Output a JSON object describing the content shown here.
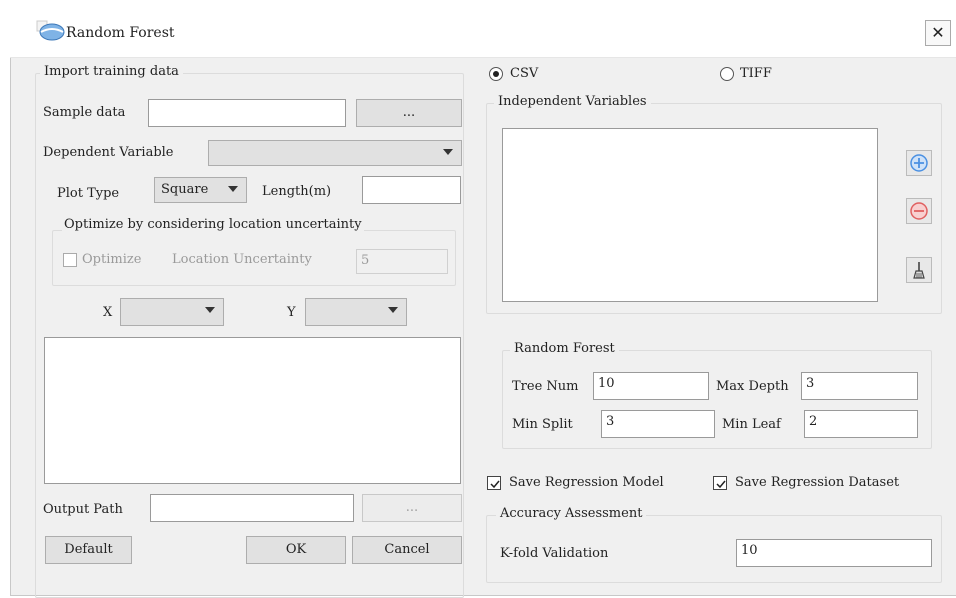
{
  "window": {
    "title": "Random Forest",
    "close_glyph": "✕"
  },
  "import": {
    "group_title": "Import training data",
    "sample_data_label": "Sample data",
    "sample_data_value": "",
    "browse_label": "...",
    "dependent_label": "Dependent Variable",
    "dependent_value": "",
    "plot_type_label": "Plot Type",
    "plot_type_value": "Square",
    "length_label": "Length(m)",
    "length_value": "",
    "optimize_group_title": "Optimize by considering location uncertainty",
    "optimize_label": "Optimize",
    "optimize_checked": false,
    "location_uncertainty_label": "Location Uncertainty",
    "location_uncertainty_value": "5",
    "x_label": "X",
    "x_value": "",
    "y_label": "Y",
    "y_value": ""
  },
  "output": {
    "path_label": "Output Path",
    "path_value": "",
    "browse_label": "..."
  },
  "buttons": {
    "default": "Default",
    "ok": "OK",
    "cancel": "Cancel"
  },
  "format": {
    "csv_label": "CSV",
    "tiff_label": "TIFF",
    "selected": "CSV"
  },
  "independent": {
    "group_title": "Independent Variables",
    "items": []
  },
  "icons": {
    "add": "plus-circle-icon",
    "remove": "minus-circle-icon",
    "clear": "broom-icon"
  },
  "random_forest": {
    "group_title": "Random Forest",
    "tree_num_label": "Tree Num",
    "tree_num_value": "10",
    "max_depth_label": "Max Depth",
    "max_depth_value": "3",
    "min_split_label": "Min Split",
    "min_split_value": "3",
    "min_leaf_label": "Min Leaf",
    "min_leaf_value": "2"
  },
  "save": {
    "model_label": "Save Regression Model",
    "model_checked": true,
    "dataset_label": "Save Regression Dataset",
    "dataset_checked": true
  },
  "accuracy": {
    "group_title": "Accuracy Assessment",
    "kfold_label": "K-fold Validation",
    "kfold_value": "10"
  },
  "colors": {
    "add": "#4a90e2",
    "remove": "#e06060"
  }
}
